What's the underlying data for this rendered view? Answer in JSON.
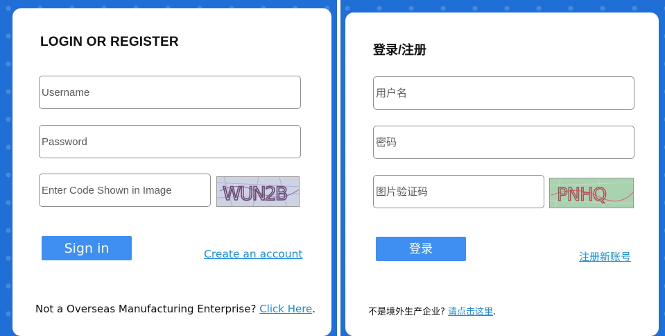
{
  "left_panel": {
    "title": "LOGIN OR REGISTER",
    "username_placeholder": "Username",
    "password_placeholder": "Password",
    "code_placeholder": "Enter Code Shown in Image",
    "captcha_text": "WUN2B",
    "signin_label": "Sign in",
    "create_account_label": "Create an account",
    "footer_text": "Not a Overseas Manufacturing Enterprise? ",
    "footer_link": "Click Here",
    "footer_end": "."
  },
  "right_panel": {
    "title": "登录/注册",
    "username_placeholder": "用户名",
    "password_placeholder": "密码",
    "code_placeholder": "图片验证码",
    "captcha_text": "PNHQ",
    "signin_label": "登录",
    "create_account_label": "注册新账号",
    "footer_text": "不是境外生产企业? ",
    "footer_link": "请点击这里",
    "footer_end": "."
  },
  "colors": {
    "background": "#1f6fd6",
    "button": "#3f8ff2",
    "link": "#1a8fd6"
  }
}
